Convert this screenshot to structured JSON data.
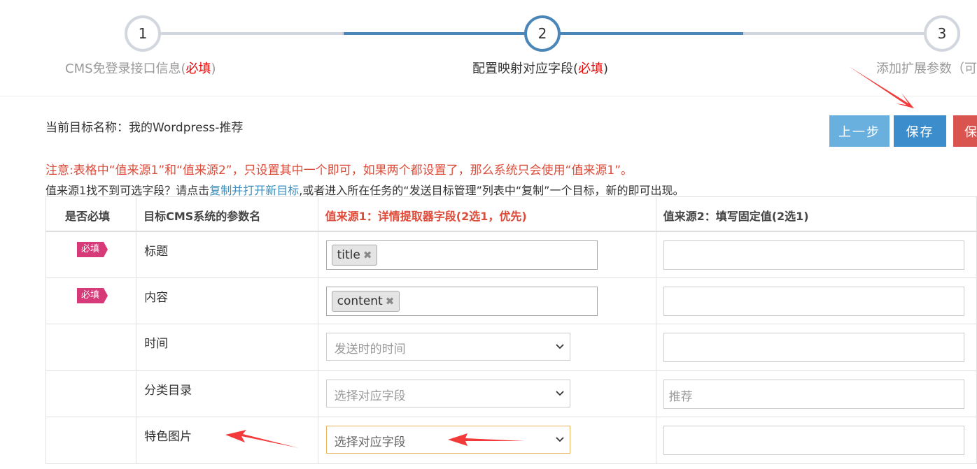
{
  "stepper": {
    "steps": [
      {
        "num": "1",
        "label": "CMS免登录接口信息(",
        "req": "必填",
        "close": ")"
      },
      {
        "num": "2",
        "label": "配置映射对应字段(",
        "req": "必填",
        "close": ")"
      },
      {
        "num": "3",
        "label": "添加扩展参数（可"
      }
    ]
  },
  "header": {
    "target_name": "当前目标名称：我的Wordpress-推荐",
    "prev_label": "上一步",
    "save_label": "保存",
    "save2_label": "保"
  },
  "notice": "注意:表格中“值来源1”和“值来源2”，只设置其中一个即可，如果两个都设置了，那么系统只会使用“值来源1”。",
  "hint": {
    "before": "值来源1找不到可选字段？请点击",
    "link": "复制并打开新目标",
    "after": ",或者进入所在任务的“发送目标管理”列表中“复制”一个目标，新的即可出现。"
  },
  "table": {
    "headers": [
      "是否必填",
      "目标CMS系统的参数名",
      "值来源1：详情提取器字段(2选1，优先)",
      "值来源2：填写固定值(2选1)"
    ],
    "rows": [
      {
        "required": "必填",
        "name": "标题",
        "tag": "title"
      },
      {
        "required": "必填",
        "name": "内容",
        "tag": "content"
      },
      {
        "name": "时间",
        "select": "发送时的时间"
      },
      {
        "name": "分类目录",
        "select": "选择对应字段",
        "fixed": "推荐"
      },
      {
        "name": "特色图片",
        "select": "选择对应字段"
      }
    ]
  },
  "colors": {
    "accent": "#4a86b8",
    "required_badge": "#d73a78",
    "notice": "#dd4b39",
    "arrow": "#f23a3a"
  }
}
